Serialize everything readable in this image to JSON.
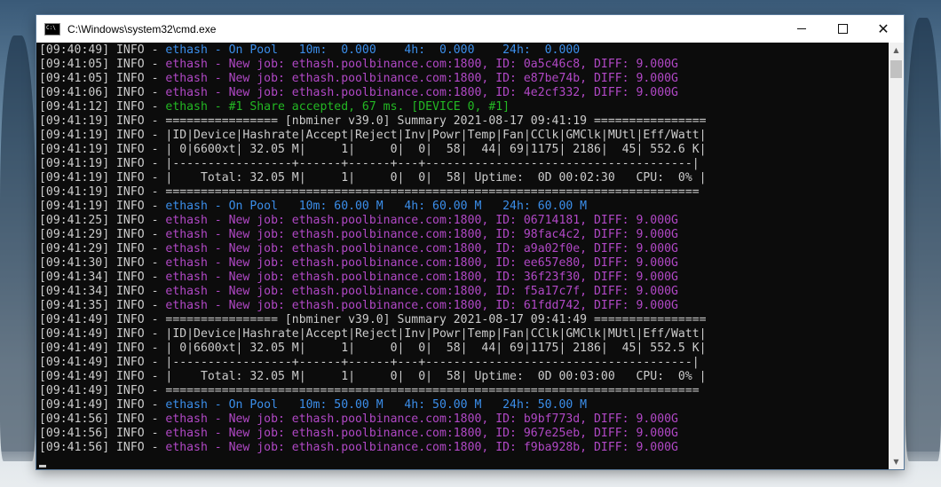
{
  "window": {
    "title": "C:\\Windows\\system32\\cmd.exe",
    "icon": "cmd-icon",
    "controls": {
      "minimize": "minimize-icon",
      "maximize": "maximize-icon",
      "close": "✕"
    }
  },
  "console": {
    "lines": [
      {
        "t": "[09:40:49] INFO - ",
        "m": "ethash - On Pool   10m:  0.000    4h:  0.000    24h:  0.000",
        "c": "blue"
      },
      {
        "t": "[09:41:05] INFO - ",
        "m": "ethash - New job: ethash.poolbinance.com:1800, ID: 0a5c46c8, DIFF: 9.000G",
        "c": "mag"
      },
      {
        "t": "[09:41:05] INFO - ",
        "m": "ethash - New job: ethash.poolbinance.com:1800, ID: e87be74b, DIFF: 9.000G",
        "c": "mag"
      },
      {
        "t": "[09:41:06] INFO - ",
        "m": "ethash - New job: ethash.poolbinance.com:1800, ID: 4e2cf332, DIFF: 9.000G",
        "c": "mag"
      },
      {
        "t": "[09:41:12] INFO - ",
        "m": "ethash - #1 Share accepted, 67 ms. [DEVICE 0, #1]",
        "c": "green"
      },
      {
        "t": "[09:41:19] INFO - ",
        "m": "================ [nbminer v39.0] Summary 2021-08-17 09:41:19 ================",
        "c": "gray"
      },
      {
        "t": "[09:41:19] INFO - ",
        "m": "|ID|Device|Hashrate|Accept|Reject|Inv|Powr|Temp|Fan|CClk|GMClk|MUtl|Eff/Watt|",
        "c": "gray"
      },
      {
        "t": "[09:41:19] INFO - ",
        "m": "| 0|6600xt| 32.05 M|     1|     0|  0|  58|  44| 69|1175| 2186|  45| 552.6 K|",
        "c": "gray"
      },
      {
        "t": "[09:41:19] INFO - ",
        "m": "|-----------------+------+------+---+--------------------------------------|",
        "c": "gray"
      },
      {
        "t": "[09:41:19] INFO - ",
        "m": "|    Total: 32.05 M|     1|     0|  0|  58| Uptime:  0D 00:02:30   CPU:  0% |",
        "c": "gray"
      },
      {
        "t": "[09:41:19] INFO - ",
        "m": "============================================================================",
        "c": "gray"
      },
      {
        "t": "[09:41:19] INFO - ",
        "m": "ethash - On Pool   10m: 60.00 M   4h: 60.00 M   24h: 60.00 M",
        "c": "blue"
      },
      {
        "t": "[09:41:25] INFO - ",
        "m": "ethash - New job: ethash.poolbinance.com:1800, ID: 06714181, DIFF: 9.000G",
        "c": "mag"
      },
      {
        "t": "[09:41:29] INFO - ",
        "m": "ethash - New job: ethash.poolbinance.com:1800, ID: 98fac4c2, DIFF: 9.000G",
        "c": "mag"
      },
      {
        "t": "[09:41:29] INFO - ",
        "m": "ethash - New job: ethash.poolbinance.com:1800, ID: a9a02f0e, DIFF: 9.000G",
        "c": "mag"
      },
      {
        "t": "[09:41:30] INFO - ",
        "m": "ethash - New job: ethash.poolbinance.com:1800, ID: ee657e80, DIFF: 9.000G",
        "c": "mag"
      },
      {
        "t": "[09:41:34] INFO - ",
        "m": "ethash - New job: ethash.poolbinance.com:1800, ID: 36f23f30, DIFF: 9.000G",
        "c": "mag"
      },
      {
        "t": "[09:41:34] INFO - ",
        "m": "ethash - New job: ethash.poolbinance.com:1800, ID: f5a17c7f, DIFF: 9.000G",
        "c": "mag"
      },
      {
        "t": "[09:41:35] INFO - ",
        "m": "ethash - New job: ethash.poolbinance.com:1800, ID: 61fdd742, DIFF: 9.000G",
        "c": "mag"
      },
      {
        "t": "[09:41:49] INFO - ",
        "m": "================ [nbminer v39.0] Summary 2021-08-17 09:41:49 ================",
        "c": "gray"
      },
      {
        "t": "[09:41:49] INFO - ",
        "m": "|ID|Device|Hashrate|Accept|Reject|Inv|Powr|Temp|Fan|CClk|GMClk|MUtl|Eff/Watt|",
        "c": "gray"
      },
      {
        "t": "[09:41:49] INFO - ",
        "m": "| 0|6600xt| 32.05 M|     1|     0|  0|  58|  44| 69|1175| 2186|  45| 552.5 K|",
        "c": "gray"
      },
      {
        "t": "[09:41:49] INFO - ",
        "m": "|-----------------+------+------+---+--------------------------------------|",
        "c": "gray"
      },
      {
        "t": "[09:41:49] INFO - ",
        "m": "|    Total: 32.05 M|     1|     0|  0|  58| Uptime:  0D 00:03:00   CPU:  0% |",
        "c": "gray"
      },
      {
        "t": "[09:41:49] INFO - ",
        "m": "============================================================================",
        "c": "gray"
      },
      {
        "t": "[09:41:49] INFO - ",
        "m": "ethash - On Pool   10m: 50.00 M   4h: 50.00 M   24h: 50.00 M",
        "c": "blue"
      },
      {
        "t": "[09:41:56] INFO - ",
        "m": "ethash - New job: ethash.poolbinance.com:1800, ID: b9bf773d, DIFF: 9.000G",
        "c": "mag"
      },
      {
        "t": "[09:41:56] INFO - ",
        "m": "ethash - New job: ethash.poolbinance.com:1800, ID: 967e25eb, DIFF: 9.000G",
        "c": "mag"
      },
      {
        "t": "[09:41:56] INFO - ",
        "m": "ethash - New job: ethash.poolbinance.com:1800, ID: f9ba928b, DIFF: 9.000G",
        "c": "mag"
      }
    ]
  },
  "colors": {
    "background": "#0c0c0c",
    "text": "#cccccc",
    "blue": "#3b8eea",
    "magenta": "#b148c6",
    "green": "#23b823"
  }
}
